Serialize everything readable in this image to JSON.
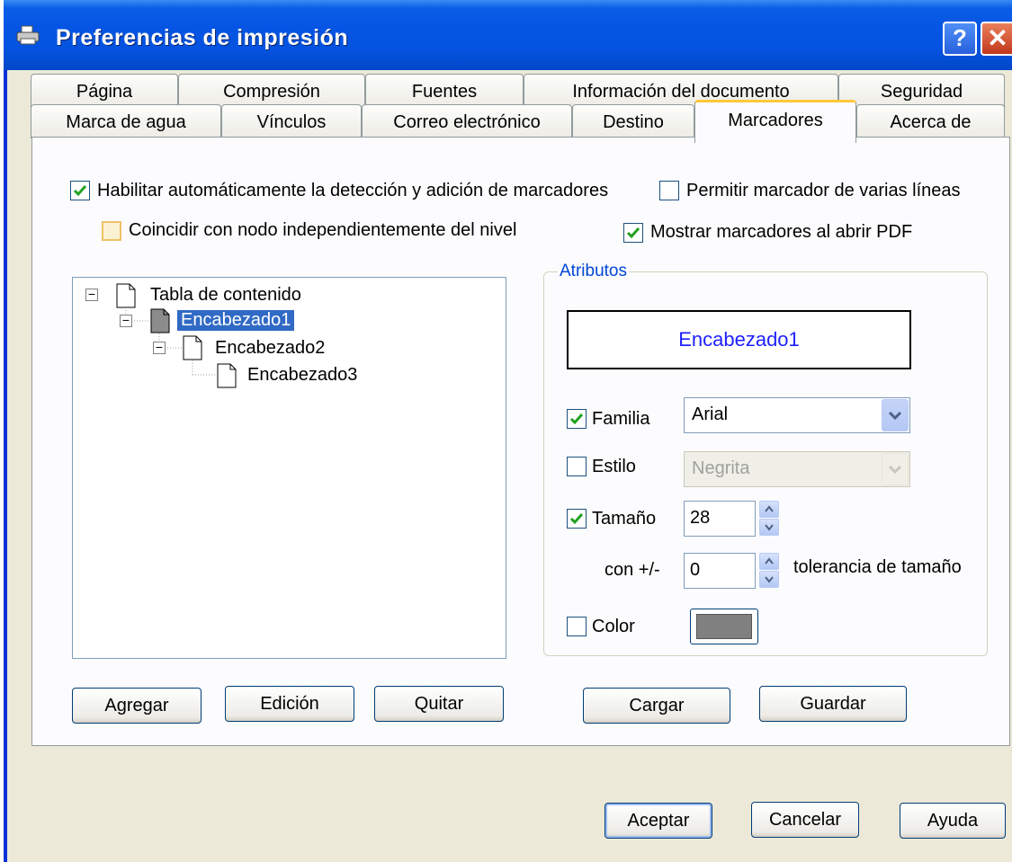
{
  "window": {
    "title": "Preferencias de impresión",
    "help_button": "?",
    "close_button": "✕"
  },
  "tabs_back": [
    "Página",
    "Compresión",
    "Fuentes",
    "Información del documento",
    "Seguridad"
  ],
  "tabs_front": [
    "Marca de agua",
    "Vínculos",
    "Correo electrónico",
    "Destino",
    "Marcadores",
    "Acerca de"
  ],
  "active_tab": "Marcadores",
  "options": {
    "auto_detect": {
      "label": "Habilitar automáticamente la detección y adición de marcadores",
      "checked": true
    },
    "multi_line": {
      "label": "Permitir marcador de varias líneas",
      "checked": false
    },
    "match_node": {
      "label": "Coincidir con nodo independientemente del nivel",
      "checked": false
    },
    "show_on_open": {
      "label": "Mostrar marcadores al abrir PDF",
      "checked": true
    }
  },
  "tree": {
    "root": "Tabla de contenido",
    "h1": "Encabezado1",
    "h2": "Encabezado2",
    "h3": "Encabezado3"
  },
  "attributes": {
    "title": "Atributos",
    "preview": "Encabezado1",
    "family": {
      "label": "Familia",
      "checked": true,
      "value": "Arial"
    },
    "style": {
      "label": "Estilo",
      "checked": false,
      "value": "Negrita"
    },
    "size": {
      "label": "Tamaño",
      "checked": true,
      "value": "28"
    },
    "tolerance": {
      "prefix": "con +/-",
      "value": "0",
      "suffix": "tolerancia de tamaño"
    },
    "color": {
      "label": "Color",
      "checked": false,
      "swatch": "#808080"
    }
  },
  "tree_buttons": {
    "add": "Agregar",
    "edit": "Edición",
    "remove": "Quitar"
  },
  "file_buttons": {
    "load": "Cargar",
    "save": "Guardar"
  },
  "dialog_buttons": {
    "ok": "Aceptar",
    "cancel": "Cancelar",
    "help": "Ayuda"
  }
}
